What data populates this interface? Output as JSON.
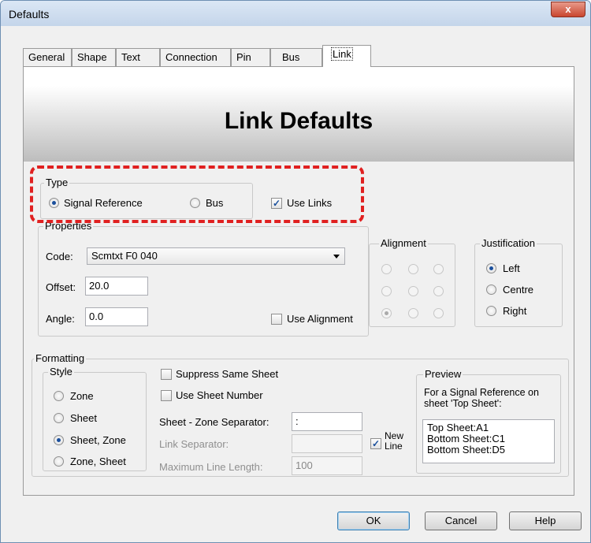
{
  "window": {
    "title": "Defaults",
    "close_glyph": "x"
  },
  "tabs": [
    "General",
    "Shape",
    "Text",
    "Connection",
    "Pin",
    "Bus",
    "Link"
  ],
  "banner": {
    "title": "Link Defaults"
  },
  "type_group": {
    "label": "Type",
    "signal_reference": "Signal Reference",
    "bus": "Bus",
    "use_links": "Use Links",
    "selected": "Signal Reference",
    "use_links_checked": true
  },
  "properties": {
    "label": "Properties",
    "code_label": "Code:",
    "code_value": "Scmtxt F0 040",
    "offset_label": "Offset:",
    "offset_value": "20.0",
    "angle_label": "Angle:",
    "angle_value": "0.0",
    "use_alignment": "Use Alignment",
    "use_alignment_checked": false
  },
  "alignment": {
    "label": "Alignment"
  },
  "justification": {
    "label": "Justification",
    "options": [
      "Left",
      "Centre",
      "Right"
    ],
    "selected": "Left"
  },
  "formatting": {
    "label": "Formatting",
    "style": {
      "label": "Style",
      "options": [
        "Zone",
        "Sheet",
        "Sheet, Zone",
        "Zone, Sheet"
      ],
      "selected": "Sheet, Zone"
    },
    "suppress_same_sheet": "Suppress Same Sheet",
    "use_sheet_number": "Use Sheet Number",
    "zone_separator_label": "Sheet - Zone Separator:",
    "zone_separator_value": ":",
    "link_separator_label": "Link Separator:",
    "link_separator_value": "",
    "max_line_length_label": "Maximum Line Length:",
    "max_line_length_value": "100",
    "new_line_label": "New Line",
    "new_line_checked": true,
    "preview": {
      "label": "Preview",
      "caption": "For a Signal Reference on sheet 'Top Sheet':",
      "lines": [
        "Top Sheet:A1",
        "Bottom Sheet:C1",
        "Bottom Sheet:D5"
      ]
    }
  },
  "buttons": {
    "ok": "OK",
    "cancel": "Cancel",
    "help": "Help"
  },
  "highlight_color": "#e02020"
}
